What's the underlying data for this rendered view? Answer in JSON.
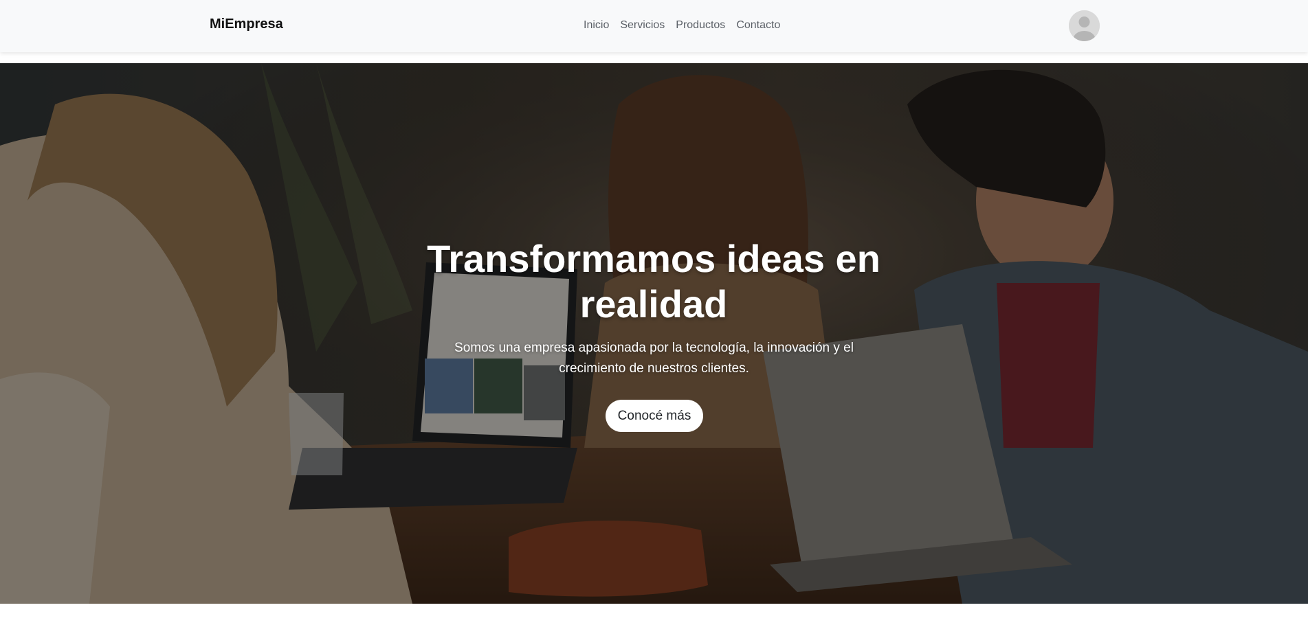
{
  "navbar": {
    "brand": "MiEmpresa",
    "links": [
      {
        "label": "Inicio"
      },
      {
        "label": "Servicios"
      },
      {
        "label": "Productos"
      },
      {
        "label": "Contacto"
      }
    ],
    "avatar_icon": "user-avatar-icon"
  },
  "hero": {
    "title": "Transformamos ideas en realidad",
    "subtitle": "Somos una empresa apasionada por la tecnología, la innovación y el crecimiento de nuestros clientes.",
    "button_label": "Conocé más"
  },
  "colors": {
    "navbar_bg": "#f8f9fa",
    "hero_text": "#ffffff",
    "button_bg": "#ffffff",
    "button_text": "#212529"
  }
}
